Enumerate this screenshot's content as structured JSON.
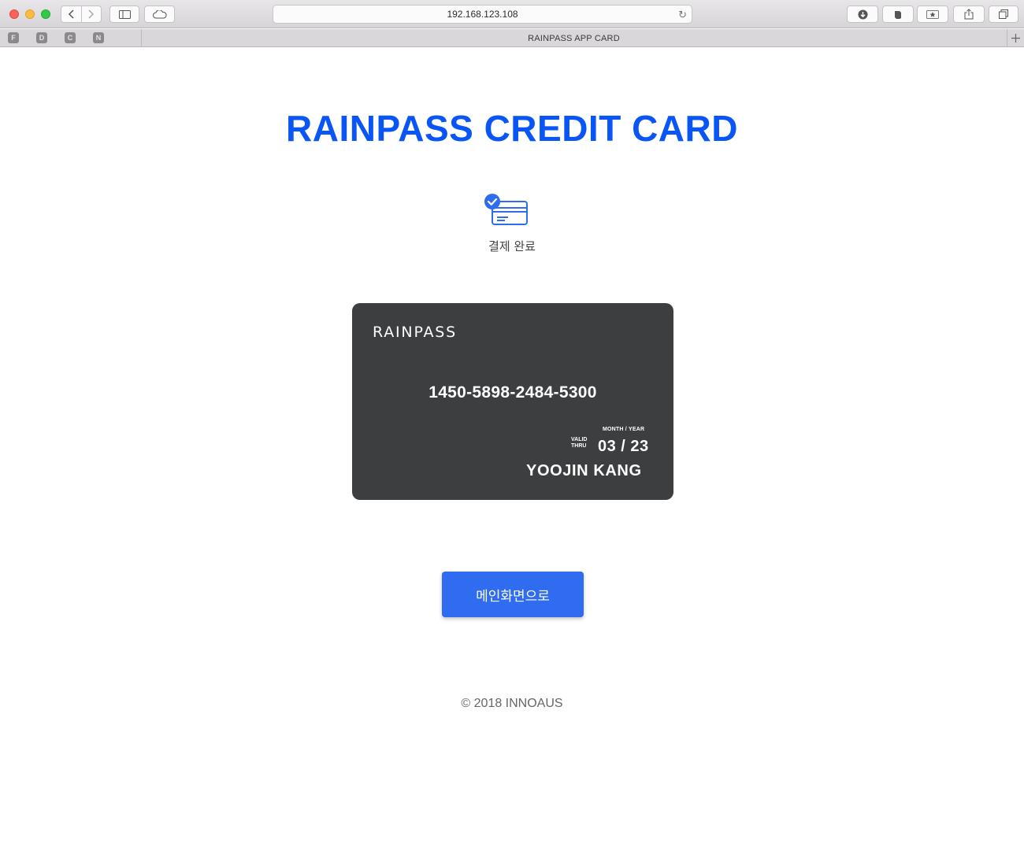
{
  "browser": {
    "url": "192.168.123.108",
    "tab_title": "RAINPASS APP CARD",
    "favorites": [
      "F",
      "D",
      "C",
      "N"
    ]
  },
  "page": {
    "title": "RAINPASS CREDIT CARD",
    "status_text": "결제 완료",
    "status_icon": "card-check-icon",
    "accent_color": "#0a55f5"
  },
  "card": {
    "brand": "RAINPASS",
    "number": "1450-5898-2484-5300",
    "valid_label_1": "VALID",
    "valid_label_2": "THRU",
    "month_year_label": "MONTH / YEAR",
    "expiry": "03 / 23",
    "holder": "YOOJIN KANG",
    "background_color": "#3d3e40"
  },
  "actions": {
    "main_button_label": "메인화면으로"
  },
  "footer": {
    "copyright": "© 2018 INNOAUS"
  }
}
